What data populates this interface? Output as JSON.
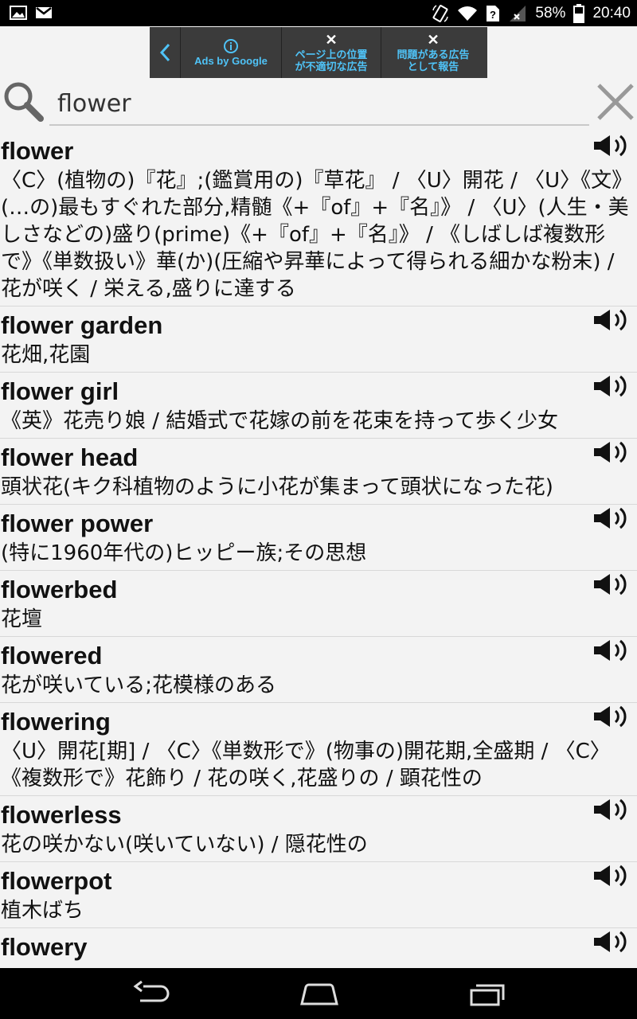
{
  "status_bar": {
    "battery": "58%",
    "time": "20:40",
    "left_icons": [
      "gallery-icon",
      "gmail-icon"
    ],
    "right_icons": [
      "rotation-icon",
      "wifi-icon",
      "unknown-sim-icon",
      "signal-icon",
      "battery-icon"
    ]
  },
  "ad": {
    "label": "Ads by Google",
    "report_position": "ページ上の位置\nが不適切な広告",
    "report_problem": "問題がある広告\nとして報告"
  },
  "search": {
    "value": "flower",
    "placeholder": ""
  },
  "entries": [
    {
      "word": "flower",
      "definition": "〈C〉(植物の)『花』;(鑑賞用の)『草花』 / 〈U〉開花 / 〈U〉《文》(…の)最もすぐれた部分,精髄《+『of』+『名』》 / 〈U〉(人生・美しさなどの)盛り(prime)《+『of』+『名』》 / 《しばしば複数形で》《単数扱い》華(か)(圧縮や昇華によって得られる細かな粉末) / 花が咲く / 栄える,盛りに達する"
    },
    {
      "word": "flower garden",
      "definition": "花畑,花園"
    },
    {
      "word": "flower girl",
      "definition": "《英》花売り娘 / 結婚式で花嫁の前を花束を持って歩く少女"
    },
    {
      "word": "flower head",
      "definition": "頭状花(キク科植物のように小花が集まって頭状になった花)"
    },
    {
      "word": "flower power",
      "definition": "(特に1960年代の)ヒッピー族;その思想"
    },
    {
      "word": "flowerbed",
      "definition": "花壇"
    },
    {
      "word": "flowered",
      "definition": "花が咲いている;花模様のある"
    },
    {
      "word": "flowering",
      "definition": "〈U〉開花[期] / 〈C〉《単数形で》(物事の)開花期,全盛期 / 〈C〉《複数形で》花飾り / 花の咲く,花盛りの / 顕花性の"
    },
    {
      "word": "flowerless",
      "definition": "花の咲かない(咲いていない) / 隠花性の"
    },
    {
      "word": "flowerpot",
      "definition": "植木ばち"
    },
    {
      "word": "flowery",
      "definition": ""
    }
  ],
  "nav": {
    "icons": [
      "back-icon",
      "home-icon",
      "recent-apps-icon"
    ]
  }
}
